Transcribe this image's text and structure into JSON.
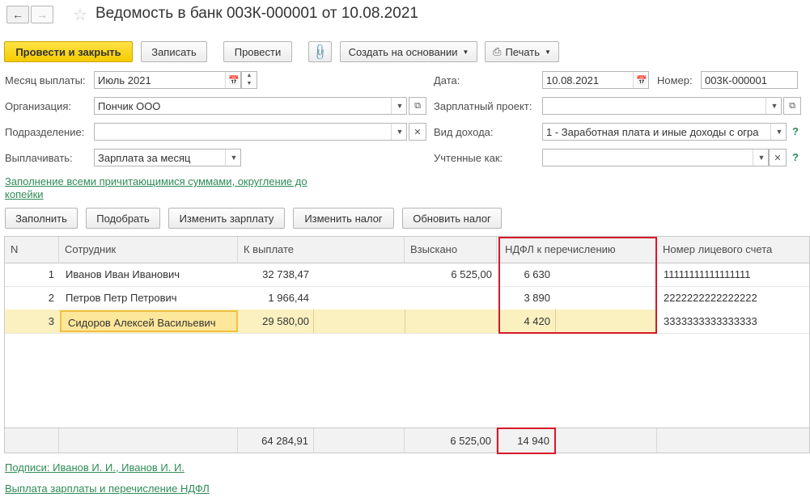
{
  "title": "Ведомость в банк 003К-000001 от 10.08.2021",
  "toolbar": {
    "post_close": "Провести и закрыть",
    "save": "Записать",
    "post": "Провести",
    "create_based": "Создать на основании",
    "print": "Печать"
  },
  "form": {
    "month_label": "Месяц выплаты:",
    "month_value": "Июль 2021",
    "org_label": "Организация:",
    "org_value": "Пончик ООО",
    "dept_label": "Подразделение:",
    "dept_value": "",
    "pay_label": "Выплачивать:",
    "pay_value": "Зарплата за месяц",
    "date_label": "Дата:",
    "date_value": "10.08.2021",
    "number_label": "Номер:",
    "number_value": "003К-000001",
    "salary_project_label": "Зарплатный проект:",
    "salary_project_value": "",
    "income_type_label": "Вид дохода:",
    "income_type_value": "1 - Заработная плата и иные доходы с огра",
    "counted_as_label": "Учтенные как:",
    "counted_as_value": ""
  },
  "fill_link": "Заполнение всеми причитающимися суммами, округление до копейки",
  "fill_link_line1": "Заполнение всеми причитающимися суммами, округление до",
  "fill_link_line2": "копейки",
  "actions": {
    "fill": "Заполнить",
    "pick": "Подобрать",
    "change_salary": "Изменить зарплату",
    "change_tax": "Изменить налог",
    "update_tax": "Обновить налог"
  },
  "table": {
    "columns": [
      "N",
      "Сотрудник",
      "К выплате",
      "Взыскано",
      "НДФЛ к перечислению",
      "Номер лицевого счета"
    ],
    "rows": [
      {
        "n": "1",
        "employee": "Иванов Иван Иванович",
        "pay": "32 738,47",
        "recovered": "6 525,00",
        "ndfl": "6 630",
        "account": "11111111111111111"
      },
      {
        "n": "2",
        "employee": "Петров Петр Петрович",
        "pay": "1 966,44",
        "recovered": "",
        "ndfl": "3 890",
        "account": "2222222222222222"
      },
      {
        "n": "3",
        "employee": "Сидоров Алексей Васильевич",
        "pay": "29 580,00",
        "recovered": "",
        "ndfl": "4 420",
        "account": "3333333333333333"
      }
    ],
    "totals": {
      "pay": "64 284,91",
      "recovered": "6 525,00",
      "ndfl": "14 940"
    }
  },
  "bottom_links": {
    "signatures": "Подписи: Иванов И. И., Иванов И. И.",
    "payment": "Выплата зарплаты и перечисление НДФЛ"
  },
  "colors": {
    "primary": "#f5cb00",
    "link": "#2e8b57",
    "highlight": "#d6182a",
    "selected_row": "#fbf0c0"
  }
}
